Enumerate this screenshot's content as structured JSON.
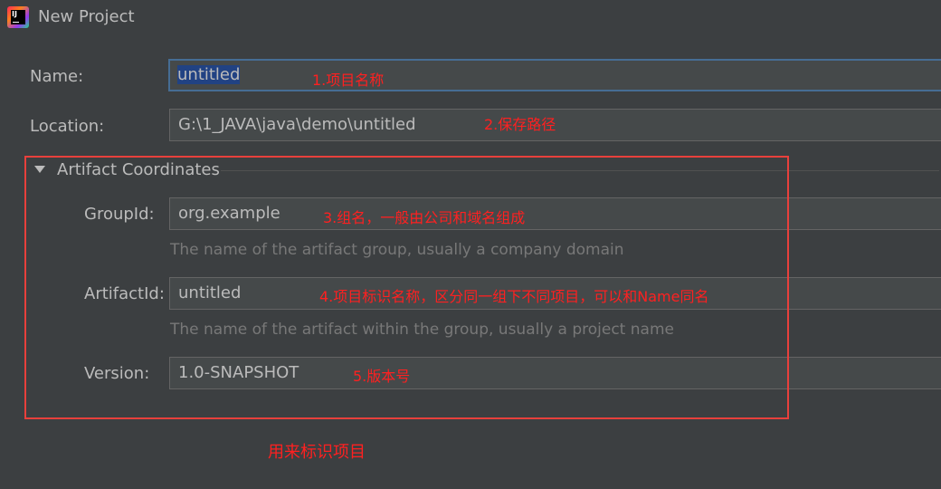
{
  "window": {
    "title": "New Project",
    "logo_text": "IJ"
  },
  "form": {
    "name": {
      "label": "Name:",
      "value": "untitled"
    },
    "location": {
      "label": "Location:",
      "value": "G:\\1_JAVA\\java\\demo\\untitled"
    }
  },
  "artifact": {
    "section_title": "Artifact Coordinates",
    "group_id": {
      "label": "GroupId:",
      "value": "org.example",
      "hint": "The name of the artifact group, usually a company domain"
    },
    "artifact_id": {
      "label": "ArtifactId:",
      "value": "untitled",
      "hint": "The name of the artifact within the group, usually a project name"
    },
    "version": {
      "label": "Version:",
      "value": "1.0-SNAPSHOT"
    }
  },
  "annotations": {
    "name": "1.项目名称",
    "location": "2.保存路径",
    "group_id": "3.组名，一般由公司和域名组成",
    "artifact_id": "4.项目标识名称，区分同一组下不同项目，可以和Name同名",
    "version": "5.版本号",
    "box_caption": "用来标识项目"
  },
  "colors": {
    "background": "#3c3f41",
    "field_bg": "#45494a",
    "focus_border": "#466d94",
    "annotation": "#ff2020",
    "box": "#e8403c"
  }
}
